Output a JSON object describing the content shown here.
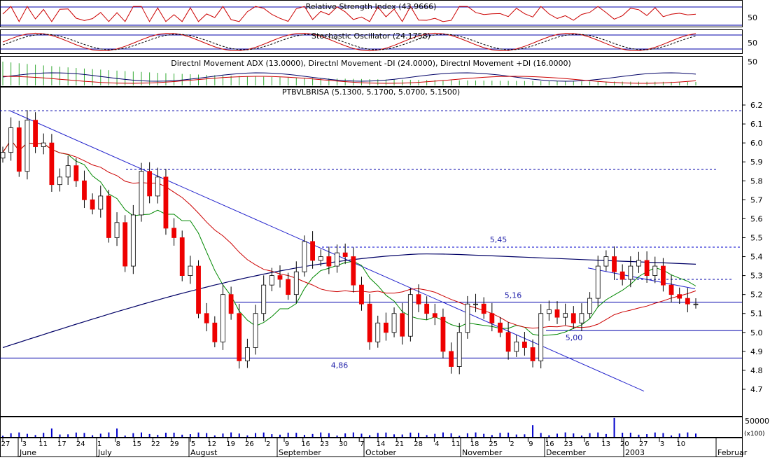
{
  "panels": {
    "rsi": {
      "title": "Relative Strength Index (43.9666)",
      "axis_label": "50"
    },
    "stochastic": {
      "title": "Stochastic Oscillator (24.1758)",
      "axis_label": "50"
    },
    "dmi": {
      "title": "Directnl Movement ADX (13.0000), Directnl Movement -DI (24.0000), Directnl Movement +DI (16.0000)",
      "axis_label": "50"
    },
    "price": {
      "title": "PTBVLBRISA (5.1300, 5.1700, 5.0700, 5.1500)"
    },
    "volume": {
      "axis_label": "50000",
      "unit_label": "(x100)"
    }
  },
  "chart_data": {
    "type": "candlestick",
    "symbol": "PTBVLBRISA",
    "last_bar": {
      "open": 5.13,
      "high": 5.17,
      "low": 5.07,
      "close": 5.15
    },
    "ylim": [
      4.63,
      6.25
    ],
    "y_ticks": [
      4.7,
      4.8,
      4.9,
      5.0,
      5.1,
      5.2,
      5.3,
      5.4,
      5.5,
      5.6,
      5.7,
      5.8,
      5.9,
      6.0,
      6.1,
      6.2
    ],
    "y_tick_labels": [
      "4.7",
      "4.8",
      "4.9",
      "5.0",
      "5.1",
      "5.2",
      "5.3",
      "5.4",
      "5.5",
      "5.6",
      "5.7",
      "5.8",
      "5.9",
      "6.0",
      "6.1",
      "6.2"
    ],
    "x_day_labels": [
      "27",
      "3",
      "11",
      "17",
      "24",
      "1",
      "8",
      "15",
      "22",
      "29",
      "5",
      "12",
      "19",
      "26",
      "2",
      "9",
      "16",
      "23",
      "30",
      "7",
      "14",
      "21",
      "28",
      "4",
      "11",
      "18",
      "25",
      "2",
      "9",
      "16",
      "23",
      "6",
      "13",
      "20",
      "27",
      "3",
      "10"
    ],
    "month_labels": [
      "June",
      "July",
      "August",
      "September",
      "October",
      "November",
      "December",
      "2003",
      "Februar"
    ],
    "levels": [
      {
        "label": "5,45",
        "value": 5.45
      },
      {
        "label": "5,16",
        "value": 5.16
      },
      {
        "label": "5,00",
        "value": 5.01
      },
      {
        "label": "4,86",
        "value": 4.865
      }
    ],
    "closes": [
      5.95,
      6.08,
      5.85,
      6.12,
      5.98,
      6.0,
      5.78,
      5.82,
      5.88,
      5.8,
      5.7,
      5.65,
      5.72,
      5.5,
      5.58,
      5.35,
      5.62,
      5.85,
      5.72,
      5.82,
      5.55,
      5.5,
      5.3,
      5.35,
      5.1,
      5.05,
      4.95,
      5.2,
      5.1,
      4.85,
      4.92,
      5.1,
      5.25,
      5.3,
      5.28,
      5.2,
      5.32,
      5.48,
      5.38,
      5.4,
      5.35,
      5.42,
      5.4,
      5.25,
      5.15,
      4.95,
      5.05,
      5.0,
      5.1,
      4.98,
      5.2,
      5.15,
      5.1,
      5.08,
      4.9,
      4.82,
      5.0,
      5.15,
      5.15,
      5.1,
      5.05,
      5.0,
      4.9,
      4.95,
      4.92,
      4.85,
      5.1,
      5.12,
      5.08,
      5.1,
      5.05,
      5.1,
      5.18,
      5.35,
      5.4,
      5.32,
      5.28,
      5.35,
      5.38,
      5.3,
      5.35,
      5.25,
      5.2,
      5.18,
      5.15,
      5.15
    ],
    "markers_2003": "2003",
    "volume_ylim": [
      0,
      70000
    ]
  }
}
